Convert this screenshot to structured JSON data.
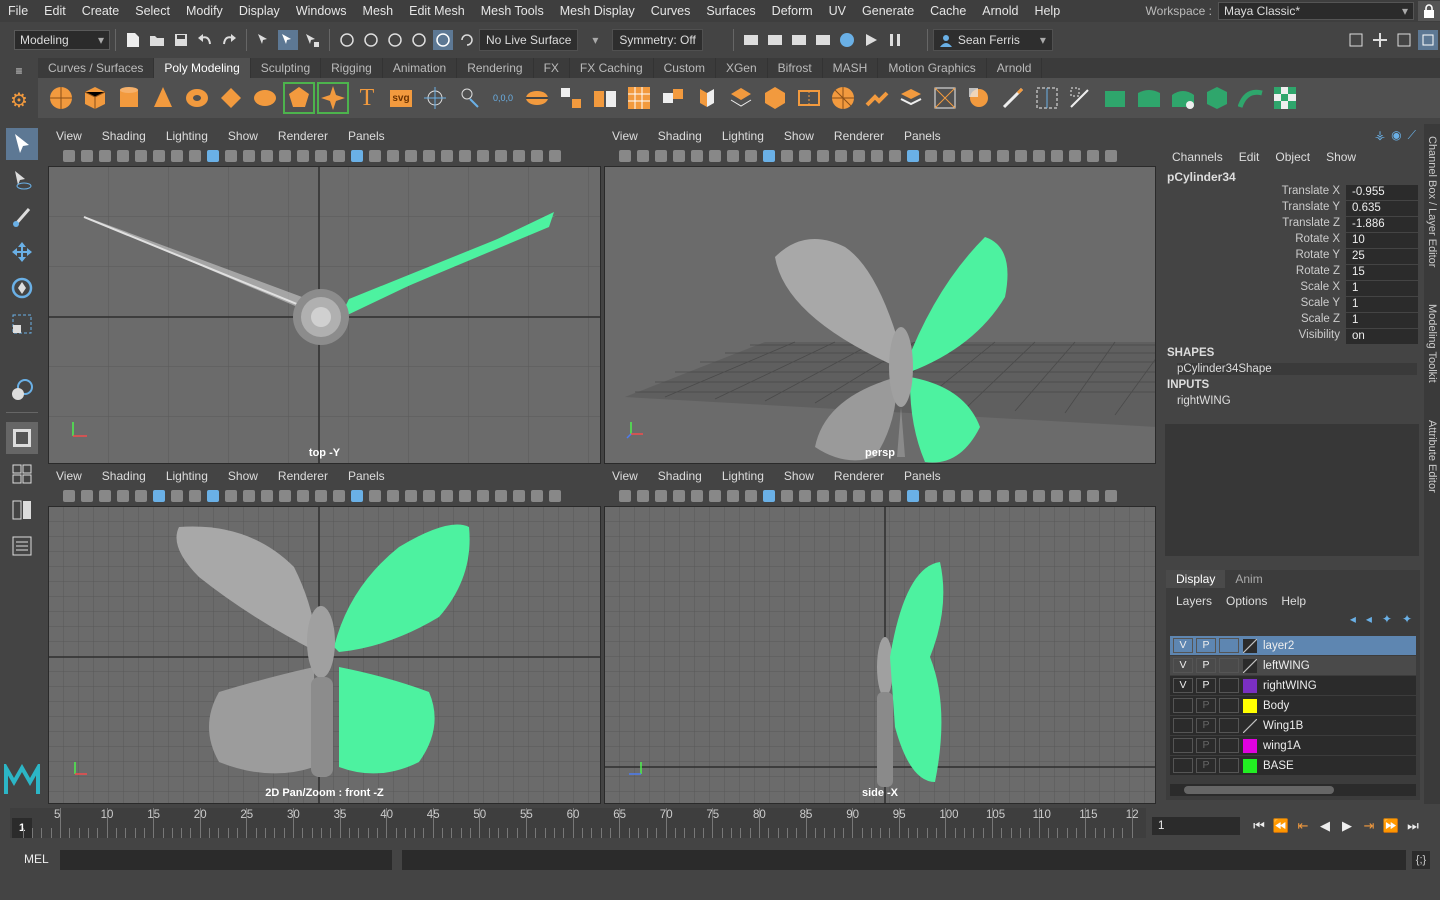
{
  "menubar": {
    "items": [
      "File",
      "Edit",
      "Create",
      "Select",
      "Modify",
      "Display",
      "Windows",
      "Mesh",
      "Edit Mesh",
      "Mesh Tools",
      "Mesh Display",
      "Curves",
      "Surfaces",
      "Deform",
      "UV",
      "Generate",
      "Cache",
      "Arnold",
      "Help"
    ],
    "workspace_label": "Workspace :",
    "workspace_value": "Maya Classic*"
  },
  "statusline": {
    "menuset": "Modeling",
    "live_surface": "No Live Surface",
    "symmetry": "Symmetry: Off",
    "user": "Sean Ferris"
  },
  "shelf": {
    "tabs": [
      "Curves / Surfaces",
      "Poly Modeling",
      "Sculpting",
      "Rigging",
      "Animation",
      "Rendering",
      "FX",
      "FX Caching",
      "Custom",
      "XGen",
      "Bifrost",
      "MASH",
      "Motion Graphics",
      "Arnold"
    ],
    "active_tab": "Poly Modeling",
    "text_icon": "T",
    "svg_icon": "svg",
    "coord_icon": "0,0,0"
  },
  "viewports": {
    "menu": [
      "View",
      "Shading",
      "Lighting",
      "Show",
      "Renderer",
      "Panels"
    ],
    "top": "top -Y",
    "persp": "persp",
    "front": "2D Pan/Zoom : front -Z",
    "side": "side -X"
  },
  "channelbox": {
    "menu": [
      "Channels",
      "Edit",
      "Object",
      "Show"
    ],
    "object": "pCylinder34",
    "attrs": [
      {
        "name": "Translate X",
        "value": "-0.955"
      },
      {
        "name": "Translate Y",
        "value": "0.635"
      },
      {
        "name": "Translate Z",
        "value": "-1.886"
      },
      {
        "name": "Rotate X",
        "value": "10"
      },
      {
        "name": "Rotate Y",
        "value": "25"
      },
      {
        "name": "Rotate Z",
        "value": "15"
      },
      {
        "name": "Scale X",
        "value": "1"
      },
      {
        "name": "Scale Y",
        "value": "1"
      },
      {
        "name": "Scale Z",
        "value": "1"
      },
      {
        "name": "Visibility",
        "value": "on"
      }
    ],
    "shapes_label": "SHAPES",
    "shape": "pCylinder34Shape",
    "inputs_label": "INPUTS",
    "input": "rightWING"
  },
  "layers": {
    "tabs": [
      "Display",
      "Anim"
    ],
    "menu": [
      "Layers",
      "Options",
      "Help"
    ],
    "rows": [
      {
        "v": "V",
        "p": "P",
        "name": "layer2",
        "color": "none"
      },
      {
        "v": "V",
        "p": "P",
        "name": "leftWING",
        "color": "none"
      },
      {
        "v": "V",
        "p": "P",
        "name": "rightWING",
        "color": "#7a2fc2"
      },
      {
        "v": "",
        "p": "P",
        "name": "Body",
        "color": "#ffff00"
      },
      {
        "v": "",
        "p": "P",
        "name": "Wing1B",
        "color": "none"
      },
      {
        "v": "",
        "p": "P",
        "name": "wing1A",
        "color": "#e000e0"
      },
      {
        "v": "",
        "p": "P",
        "name": "BASE",
        "color": "#22ee22"
      }
    ]
  },
  "sidetabs": [
    "Channel Box / Layer Editor",
    "Modeling Toolkit",
    "Attribute Editor"
  ],
  "timeslider": {
    "current": "1",
    "ticks": [
      "5",
      "10",
      "15",
      "20",
      "25",
      "30",
      "35",
      "40",
      "45",
      "50",
      "55",
      "60",
      "65",
      "70",
      "75",
      "80",
      "85",
      "90",
      "95",
      "100",
      "105",
      "110",
      "115",
      "12"
    ],
    "frame": "1"
  },
  "cmdline": {
    "label": "MEL"
  },
  "colors": {
    "wing_green": "#4df2a0",
    "wing_gray": "#a8a8a8",
    "accent": "#5d7894"
  }
}
